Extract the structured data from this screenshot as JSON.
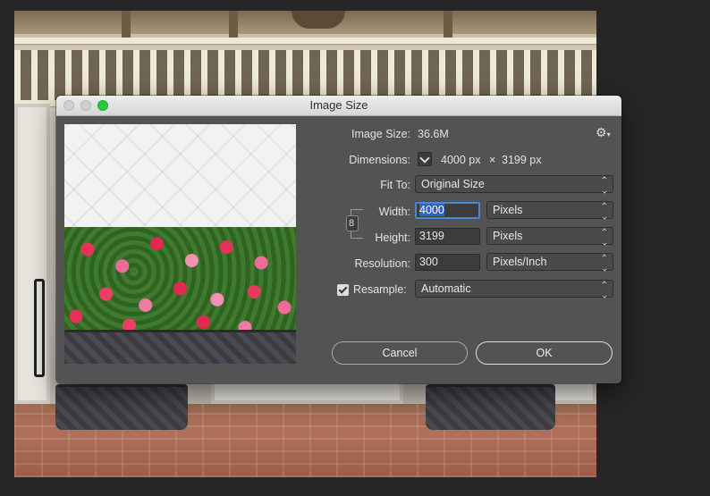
{
  "dialog": {
    "title": "Image Size",
    "image_size_label": "Image Size:",
    "image_size_value": "36.6M",
    "dimensions_label": "Dimensions:",
    "dimensions_width": "4000 px",
    "dimensions_times": "×",
    "dimensions_height": "3199 px",
    "fit_to_label": "Fit To:",
    "fit_to_value": "Original Size",
    "width_label": "Width:",
    "width_value": "4000",
    "width_unit": "Pixels",
    "height_label": "Height:",
    "height_value": "3199",
    "height_unit": "Pixels",
    "resolution_label": "Resolution:",
    "resolution_value": "300",
    "resolution_unit": "Pixels/Inch",
    "resample_label": "Resample:",
    "resample_value": "Automatic",
    "cancel_label": "Cancel",
    "ok_label": "OK"
  },
  "icons": {
    "gear": "gear-icon",
    "link": "link-icon",
    "chevron": "chevron-icon"
  },
  "colors": {
    "dialog_bg": "#535353",
    "field_focus": "#4a87d7",
    "selection": "#2e64c4",
    "zoom_button": "#27c93f"
  }
}
